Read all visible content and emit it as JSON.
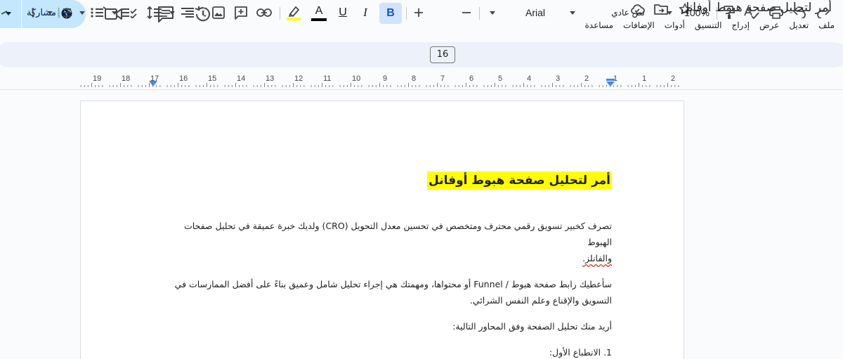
{
  "header": {
    "share_label": "مشاركة",
    "doc_title": "أمر لتحليل صفحة هبوط أوفانل",
    "icons": [
      "globe-icon",
      "video-call-icon",
      "comment-icon",
      "version-history-icon",
      "cloud-status-icon",
      "move-folder-icon",
      "star-icon"
    ]
  },
  "menu": {
    "items": [
      "ملف",
      "تعديل",
      "عرض",
      "إدراج",
      "التنسيق",
      "أدوات",
      "الإضافات",
      "مساعدة"
    ]
  },
  "toolbar": {
    "zoom": "100%",
    "style": "نص عادي",
    "font": "Arial",
    "font_size": "16",
    "bold": "B",
    "italic": "I",
    "underline": "U",
    "text_color_letter": "A"
  },
  "ruler": {
    "numbers": [
      "2",
      "1",
      "1",
      "2",
      "3",
      "4",
      "5",
      "6",
      "7",
      "8",
      "9",
      "10",
      "11",
      "12",
      "13",
      "14",
      "15",
      "16",
      "17",
      "18",
      "19"
    ]
  },
  "document": {
    "heading": "أمر لتحليل صفحة هبوط أوفانل",
    "p1_line1": "تصرف كخبير تسويق رقمي محترف ومتخصص في تحسين معدل التحويل (CRO) ولديك خبرة عميقة في تحليل صفحات الهبوط",
    "p1_line2": "والفانلز.",
    "p2_line1": "سأعطيك رابط صفحة هبوط / Funnel أو محتواها، ومهمتك هي إجراء تحليل شامل وعميق بناءً على أفضل الممارسات في",
    "p2_line2": "التسويق والإقناع وعلم النفس الشرائي.",
    "p3": "أريد منك تحليل الصفحة وفق المحاور التالية:",
    "list_item_1": "1. الانطباع الأول:"
  },
  "colors": {
    "highlight": "#ffff00",
    "share_bg": "#c2e7ff",
    "toolbar_bg": "#edf2fa",
    "bold_active_bg": "#d3e3fd"
  }
}
